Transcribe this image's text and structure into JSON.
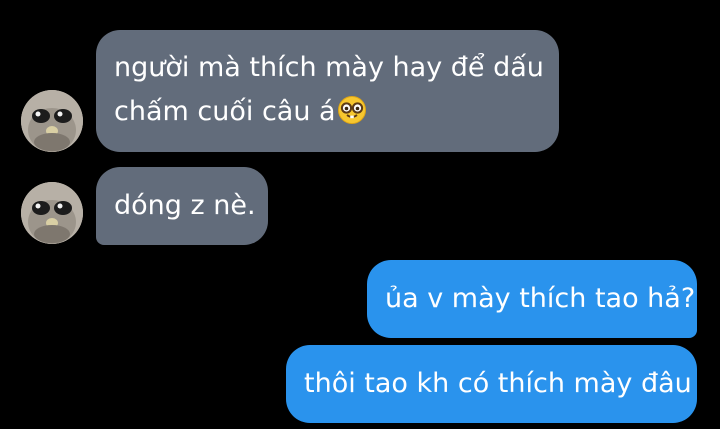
{
  "messages": [
    {
      "direction": "incoming",
      "lines": [
        "người mà thích mày hay để dấu",
        "chấm cuối câu á"
      ],
      "emoji": "nerd-face-emoji"
    },
    {
      "direction": "incoming",
      "lines": [
        "dóng z nè."
      ]
    },
    {
      "direction": "outgoing",
      "lines": [
        "ủa v mày thích tao hả?"
      ]
    },
    {
      "direction": "outgoing",
      "lines": [
        "thôi tao kh có thích mày đâu"
      ]
    }
  ],
  "colors": {
    "background": "#000000",
    "incoming_bubble": "#626c7b",
    "outgoing_bubble": "#2a93ed",
    "text": "#ffffff"
  },
  "icons": {
    "avatar": "owl-avatar-icon",
    "emoji": "nerd-face-emoji"
  }
}
